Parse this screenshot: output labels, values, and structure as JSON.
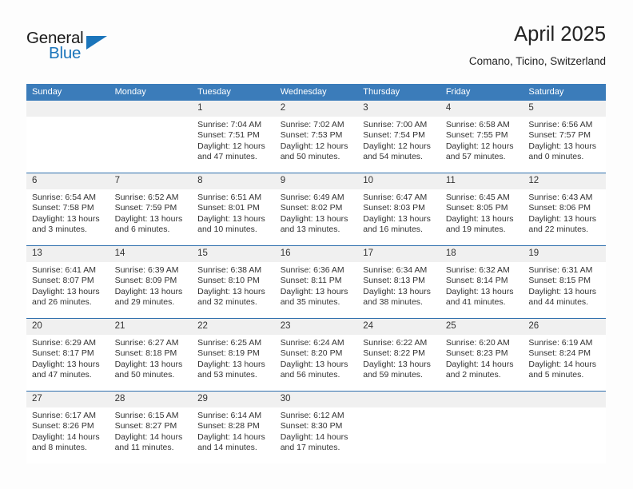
{
  "brand": {
    "name_part1": "General",
    "name_part2": "Blue",
    "accent_color": "#1b75bb"
  },
  "header": {
    "title": "April 2025",
    "location": "Comano, Ticino, Switzerland"
  },
  "theme": {
    "header_blue": "#3b7cba",
    "row_border_blue": "#2f6fad",
    "daynum_band": "#f0f0f0"
  },
  "calendar": {
    "weekday_headers": [
      "Sunday",
      "Monday",
      "Tuesday",
      "Wednesday",
      "Thursday",
      "Friday",
      "Saturday"
    ],
    "weeks": [
      [
        {
          "day": "",
          "empty": true
        },
        {
          "day": "",
          "empty": true
        },
        {
          "day": "1",
          "sunrise": "Sunrise: 7:04 AM",
          "sunset": "Sunset: 7:51 PM",
          "daylight": "Daylight: 12 hours and 47 minutes."
        },
        {
          "day": "2",
          "sunrise": "Sunrise: 7:02 AM",
          "sunset": "Sunset: 7:53 PM",
          "daylight": "Daylight: 12 hours and 50 minutes."
        },
        {
          "day": "3",
          "sunrise": "Sunrise: 7:00 AM",
          "sunset": "Sunset: 7:54 PM",
          "daylight": "Daylight: 12 hours and 54 minutes."
        },
        {
          "day": "4",
          "sunrise": "Sunrise: 6:58 AM",
          "sunset": "Sunset: 7:55 PM",
          "daylight": "Daylight: 12 hours and 57 minutes."
        },
        {
          "day": "5",
          "sunrise": "Sunrise: 6:56 AM",
          "sunset": "Sunset: 7:57 PM",
          "daylight": "Daylight: 13 hours and 0 minutes."
        }
      ],
      [
        {
          "day": "6",
          "sunrise": "Sunrise: 6:54 AM",
          "sunset": "Sunset: 7:58 PM",
          "daylight": "Daylight: 13 hours and 3 minutes."
        },
        {
          "day": "7",
          "sunrise": "Sunrise: 6:52 AM",
          "sunset": "Sunset: 7:59 PM",
          "daylight": "Daylight: 13 hours and 6 minutes."
        },
        {
          "day": "8",
          "sunrise": "Sunrise: 6:51 AM",
          "sunset": "Sunset: 8:01 PM",
          "daylight": "Daylight: 13 hours and 10 minutes."
        },
        {
          "day": "9",
          "sunrise": "Sunrise: 6:49 AM",
          "sunset": "Sunset: 8:02 PM",
          "daylight": "Daylight: 13 hours and 13 minutes."
        },
        {
          "day": "10",
          "sunrise": "Sunrise: 6:47 AM",
          "sunset": "Sunset: 8:03 PM",
          "daylight": "Daylight: 13 hours and 16 minutes."
        },
        {
          "day": "11",
          "sunrise": "Sunrise: 6:45 AM",
          "sunset": "Sunset: 8:05 PM",
          "daylight": "Daylight: 13 hours and 19 minutes."
        },
        {
          "day": "12",
          "sunrise": "Sunrise: 6:43 AM",
          "sunset": "Sunset: 8:06 PM",
          "daylight": "Daylight: 13 hours and 22 minutes."
        }
      ],
      [
        {
          "day": "13",
          "sunrise": "Sunrise: 6:41 AM",
          "sunset": "Sunset: 8:07 PM",
          "daylight": "Daylight: 13 hours and 26 minutes."
        },
        {
          "day": "14",
          "sunrise": "Sunrise: 6:39 AM",
          "sunset": "Sunset: 8:09 PM",
          "daylight": "Daylight: 13 hours and 29 minutes."
        },
        {
          "day": "15",
          "sunrise": "Sunrise: 6:38 AM",
          "sunset": "Sunset: 8:10 PM",
          "daylight": "Daylight: 13 hours and 32 minutes."
        },
        {
          "day": "16",
          "sunrise": "Sunrise: 6:36 AM",
          "sunset": "Sunset: 8:11 PM",
          "daylight": "Daylight: 13 hours and 35 minutes."
        },
        {
          "day": "17",
          "sunrise": "Sunrise: 6:34 AM",
          "sunset": "Sunset: 8:13 PM",
          "daylight": "Daylight: 13 hours and 38 minutes."
        },
        {
          "day": "18",
          "sunrise": "Sunrise: 6:32 AM",
          "sunset": "Sunset: 8:14 PM",
          "daylight": "Daylight: 13 hours and 41 minutes."
        },
        {
          "day": "19",
          "sunrise": "Sunrise: 6:31 AM",
          "sunset": "Sunset: 8:15 PM",
          "daylight": "Daylight: 13 hours and 44 minutes."
        }
      ],
      [
        {
          "day": "20",
          "sunrise": "Sunrise: 6:29 AM",
          "sunset": "Sunset: 8:17 PM",
          "daylight": "Daylight: 13 hours and 47 minutes."
        },
        {
          "day": "21",
          "sunrise": "Sunrise: 6:27 AM",
          "sunset": "Sunset: 8:18 PM",
          "daylight": "Daylight: 13 hours and 50 minutes."
        },
        {
          "day": "22",
          "sunrise": "Sunrise: 6:25 AM",
          "sunset": "Sunset: 8:19 PM",
          "daylight": "Daylight: 13 hours and 53 minutes."
        },
        {
          "day": "23",
          "sunrise": "Sunrise: 6:24 AM",
          "sunset": "Sunset: 8:20 PM",
          "daylight": "Daylight: 13 hours and 56 minutes."
        },
        {
          "day": "24",
          "sunrise": "Sunrise: 6:22 AM",
          "sunset": "Sunset: 8:22 PM",
          "daylight": "Daylight: 13 hours and 59 minutes."
        },
        {
          "day": "25",
          "sunrise": "Sunrise: 6:20 AM",
          "sunset": "Sunset: 8:23 PM",
          "daylight": "Daylight: 14 hours and 2 minutes."
        },
        {
          "day": "26",
          "sunrise": "Sunrise: 6:19 AM",
          "sunset": "Sunset: 8:24 PM",
          "daylight": "Daylight: 14 hours and 5 minutes."
        }
      ],
      [
        {
          "day": "27",
          "sunrise": "Sunrise: 6:17 AM",
          "sunset": "Sunset: 8:26 PM",
          "daylight": "Daylight: 14 hours and 8 minutes."
        },
        {
          "day": "28",
          "sunrise": "Sunrise: 6:15 AM",
          "sunset": "Sunset: 8:27 PM",
          "daylight": "Daylight: 14 hours and 11 minutes."
        },
        {
          "day": "29",
          "sunrise": "Sunrise: 6:14 AM",
          "sunset": "Sunset: 8:28 PM",
          "daylight": "Daylight: 14 hours and 14 minutes."
        },
        {
          "day": "30",
          "sunrise": "Sunrise: 6:12 AM",
          "sunset": "Sunset: 8:30 PM",
          "daylight": "Daylight: 14 hours and 17 minutes."
        },
        {
          "day": "",
          "empty": true
        },
        {
          "day": "",
          "empty": true
        },
        {
          "day": "",
          "empty": true
        }
      ]
    ]
  }
}
